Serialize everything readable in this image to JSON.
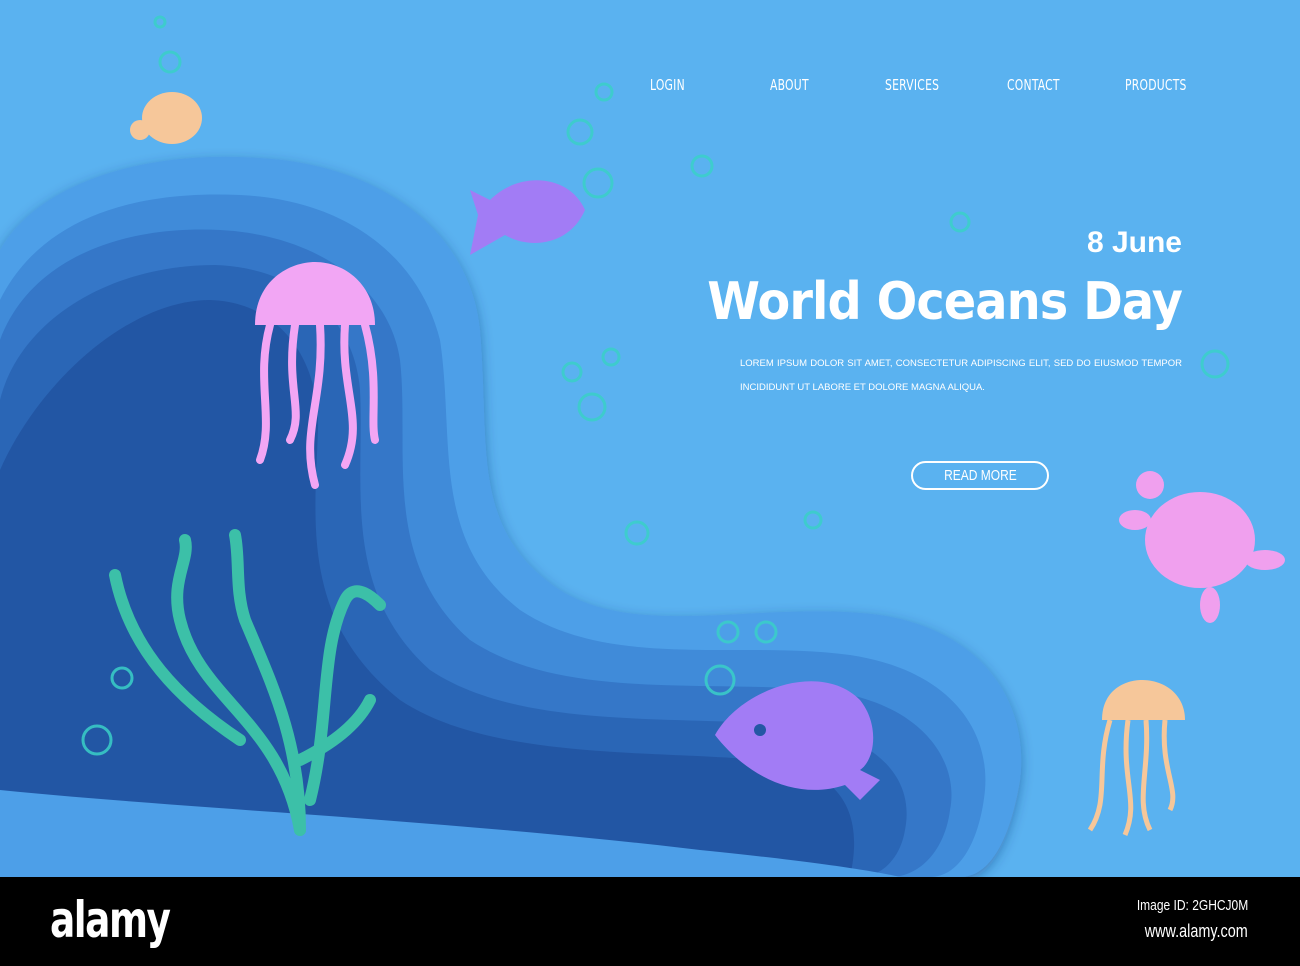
{
  "nav": {
    "items": [
      {
        "label": "LOGIN"
      },
      {
        "label": "ABOUT"
      },
      {
        "label": "SERVICES"
      },
      {
        "label": "CONTACT"
      },
      {
        "label": "PRODUCTS"
      }
    ]
  },
  "hero": {
    "date": "8 June",
    "title": "World Oceans Day",
    "description": "LOREM IPSUM DOLOR SIT AMET, CONSECTETUR ADIPISCING ELIT, SED DO EIUSMOD TEMPOR INCIDIDUNT UT LABORE ET DOLORE MAGNA ALIQUA.",
    "cta_label": "READ MORE"
  },
  "footer": {
    "logo": "alamy",
    "image_id": "Image ID: 2GHCJ0M",
    "site": "www.alamy.com"
  },
  "colors": {
    "background": "#5ab2f0",
    "layer1": "#4d9fe8",
    "layer2": "#3f8bd9",
    "layer3": "#3477c8",
    "layer4": "#2b66b6",
    "layer5": "#2457a4",
    "seaweed": "#3cc0a8",
    "jelly_pink": "#f2a6f4",
    "jelly_peach": "#f6c79a",
    "fish_purple": "#a27cf5",
    "turtle_pink": "#f0a0ee"
  }
}
